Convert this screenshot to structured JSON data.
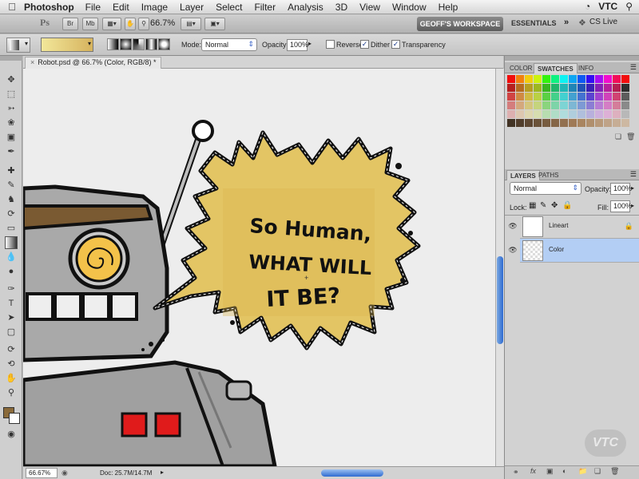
{
  "menubar": {
    "app_name": "Photoshop",
    "items": [
      "File",
      "Edit",
      "Image",
      "Layer",
      "Select",
      "Filter",
      "Analysis",
      "3D",
      "View",
      "Window",
      "Help"
    ],
    "right_text": "VTC"
  },
  "appbar": {
    "br_label": "Br",
    "mb_label": "Mb",
    "zoom": "66.7%",
    "workspace": "GEOFF'S WORKSPACE",
    "essentials": "ESSENTIALS",
    "more": "»",
    "cs_live": "CS Live"
  },
  "options": {
    "mode_label": "Mode:",
    "mode_value": "Normal",
    "opacity_label": "Opacity:",
    "opacity_value": "100%",
    "reverse_label": "Reverse",
    "dither_label": "Dither",
    "transparency_label": "Transparency",
    "reverse_checked": false,
    "dither_checked": true,
    "transparency_checked": true
  },
  "document": {
    "tab_title": "Robot.psd @ 66.7% (Color, RGB/8) *",
    "bubble_text": [
      "So Human,",
      "WHAT WILL",
      "IT BE?"
    ]
  },
  "status": {
    "zoom": "66.67%",
    "doc": "Doc: 25.7M/14.7M"
  },
  "color_panel": {
    "tabs": [
      "COLOR",
      "SWATCHES",
      "INFO"
    ],
    "active_tab": "SWATCHES"
  },
  "layers_panel": {
    "tabs": [
      "LAYERS",
      "PATHS"
    ],
    "active_tab": "LAYERS",
    "blend_mode": "Normal",
    "opacity_label": "Opacity:",
    "opacity_value": "100%",
    "lock_label": "Lock:",
    "fill_label": "Fill:",
    "fill_value": "100%",
    "layers": [
      {
        "name": "Lineart",
        "selected": false,
        "locked": true
      },
      {
        "name": "Color",
        "selected": true,
        "locked": false
      }
    ]
  },
  "watermark": "VTC"
}
